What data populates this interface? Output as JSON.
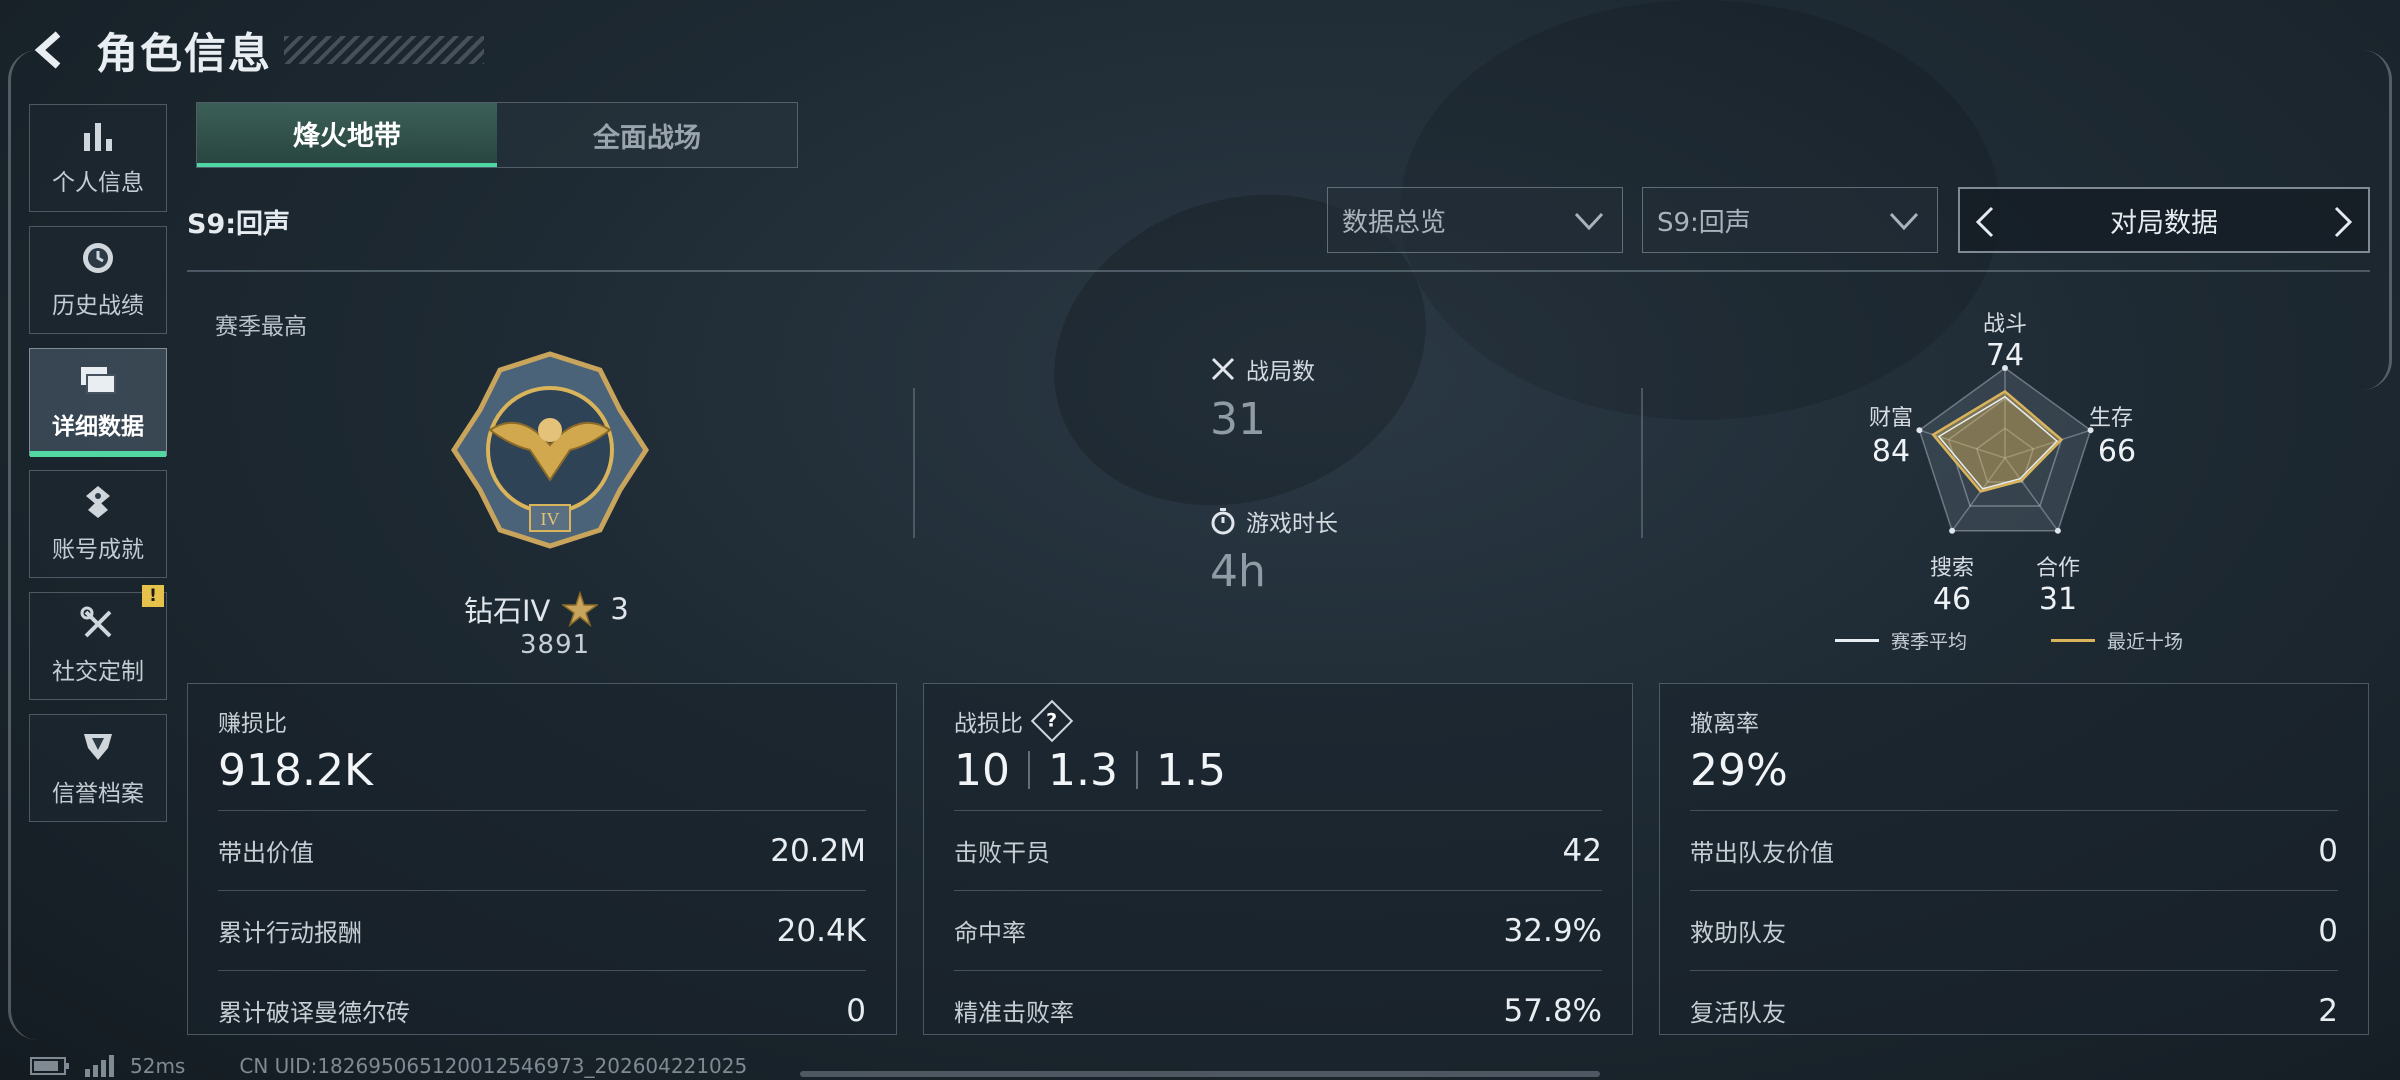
{
  "header": {
    "title": "角色信息"
  },
  "sidebar": {
    "items": [
      {
        "label": "个人信息",
        "icon": "bar-chart-icon"
      },
      {
        "label": "历史战绩",
        "icon": "history-icon"
      },
      {
        "label": "详细数据",
        "icon": "folder-icon",
        "active": true
      },
      {
        "label": "账号成就",
        "icon": "achievement-icon"
      },
      {
        "label": "社交定制",
        "icon": "tools-icon",
        "badge": "!"
      },
      {
        "label": "信誉档案",
        "icon": "shield-icon"
      }
    ]
  },
  "tabs": [
    {
      "label": "烽火地带",
      "active": true
    },
    {
      "label": "全面战场",
      "active": false
    }
  ],
  "season_label": "S9:回声",
  "filters": {
    "overview": "数据总览",
    "season": "S9:回声",
    "mode": "对局数据"
  },
  "season_best": {
    "heading": "赛季最高",
    "rank": "钻石IV",
    "stars": "3",
    "points": "3891"
  },
  "matches": {
    "label": "战局数",
    "value": "31"
  },
  "playtime": {
    "label": "游戏时长",
    "value": "4h"
  },
  "radar": {
    "axes": [
      {
        "label": "战斗",
        "value": "74"
      },
      {
        "label": "生存",
        "value": "66"
      },
      {
        "label": "合作",
        "value": "31"
      },
      {
        "label": "搜索",
        "value": "46"
      },
      {
        "label": "财富",
        "value": "84"
      }
    ],
    "legend": {
      "season_avg": "赛季平均",
      "recent10": "最近十场"
    },
    "colors": {
      "season_avg": "#e8edf1",
      "recent10": "#d9b45a"
    }
  },
  "cards": {
    "profit": {
      "title": "赚损比",
      "main": "918.2K",
      "rows": [
        {
          "label": "带出价值",
          "value": "20.2M"
        },
        {
          "label": "累计行动报酬",
          "value": "20.4K"
        },
        {
          "label": "累计破译曼德尔砖",
          "value": "0"
        }
      ]
    },
    "combat": {
      "title": "战损比",
      "help": "?",
      "main": [
        "10",
        "1.3",
        "1.5"
      ],
      "rows": [
        {
          "label": "击败干员",
          "value": "42"
        },
        {
          "label": "命中率",
          "value": "32.9%"
        },
        {
          "label": "精准击败率",
          "value": "57.8%"
        }
      ]
    },
    "extract": {
      "title": "撤离率",
      "main": "29%",
      "rows": [
        {
          "label": "带出队友价值",
          "value": "0"
        },
        {
          "label": "救助队友",
          "value": "0"
        },
        {
          "label": "复活队友",
          "value": "2"
        }
      ]
    }
  },
  "footer": {
    "ping": "52ms",
    "uid": "CN UID:1826950651200125469​73_202604221025"
  }
}
